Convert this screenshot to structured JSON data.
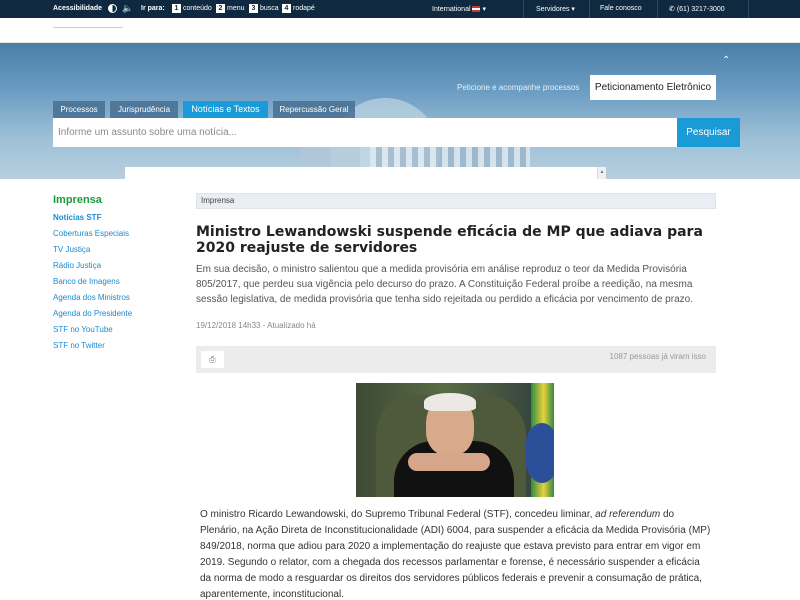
{
  "topbar": {
    "accessibility": "Acessibilidade",
    "go_to": "Ir para:",
    "skip_links": [
      {
        "num": "1",
        "label": "conteúdo"
      },
      {
        "num": "2",
        "label": "menu"
      },
      {
        "num": "3",
        "label": "busca"
      },
      {
        "num": "4",
        "label": "rodapé"
      }
    ],
    "international": "International",
    "servers": "Servidores",
    "contact": "Fale conosco",
    "phone": "(61) 3217-3000"
  },
  "banner": {
    "peticione": "Peticione e acompanhe processos",
    "petition_button": "Peticionamento Eletrônico",
    "tabs": [
      "Processos",
      "Jurisprudência",
      "Notícias e Textos",
      "Repercussão Geral"
    ],
    "search_placeholder": "Informe um assunto sobre uma notícia...",
    "search_button": "Pesquisar"
  },
  "sidebar": {
    "title": "Imprensa",
    "items": [
      "Notícias STF",
      "Coberturas Especiais",
      "TV Justiça",
      "Rádio Justiça",
      "Banco de Imagens",
      "Agenda dos Ministros",
      "Agenda do Presidente",
      "STF no YouTube",
      "STF no Twitter"
    ]
  },
  "article": {
    "breadcrumb": "Imprensa",
    "headline": "Ministro Lewandowski suspende eficácia de MP que adiava para 2020 reajuste de servidores",
    "lead": "Em sua decisão, o ministro salientou que a medida provisória em análise reproduz o teor da Medida Provisória 805/2017, que perdeu sua vigência pelo decurso do prazo. A Constituição Federal proíbe a reedição, na mesma sessão legislativa, de medida provisória que tenha sido rejeitada ou perdido a eficácia por vencimento de prazo.",
    "date": "19/12/2018 14h33 - Atualizado há",
    "views": "1087 pessoas já viram isso",
    "body_part1": "O ministro Ricardo Lewandowski, do Supremo Tribunal Federal (STF), concedeu liminar, ",
    "body_italic": "ad referendum",
    "body_part2": " do Plenário, na Ação Direta de Inconstitucionalidade (ADI) 6004, para suspender a eficácia da Medida Provisória (MP) 849/2018, norma que adiou para 2020 a implementação do reajuste que estava previsto para entrar em vigor em 2019. Segundo o relator, com a chegada dos recessos parlamentar e forense, é necessário suspender a eficácia da norma de modo a resguardar os direitos dos servidores públicos federais e prevenir a consumação de prática, aparentemente, inconstitucional."
  },
  "icons": {
    "contrast": "contrast-icon",
    "speaker": "speaker-icon",
    "flag": "us-flag-icon",
    "phone": "phone-icon",
    "print": "print-icon"
  }
}
